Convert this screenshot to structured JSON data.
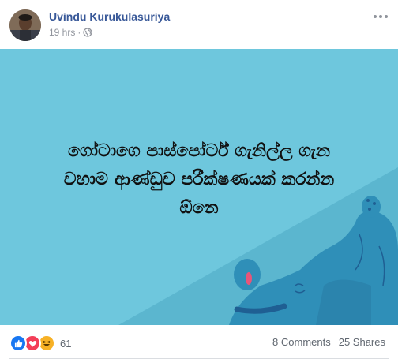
{
  "post": {
    "author": "Uvindu Kurukulasuriya",
    "time": "19 hrs",
    "separator": "·",
    "privacy_icon": "globe-icon",
    "more_icon": "more-options-icon"
  },
  "image": {
    "text_lines": [
      "ගෝටාගෙ පාස්පෝර්ට් ගැනිල්ල ගැන",
      "වහාම ආණ්ඩුව පරීක්ෂණයක් කරන්න",
      "ඕනෙ"
    ],
    "colors": {
      "background_light": "#6ec7dd",
      "background_dark": "#5bb6cf",
      "character": "#2f8fb8",
      "character_dark": "#1f5f93"
    }
  },
  "footer": {
    "reactions": [
      "like-icon",
      "love-icon",
      "haha-icon"
    ],
    "reaction_count": "61",
    "comments": "8 Comments",
    "shares": "25 Shares"
  }
}
